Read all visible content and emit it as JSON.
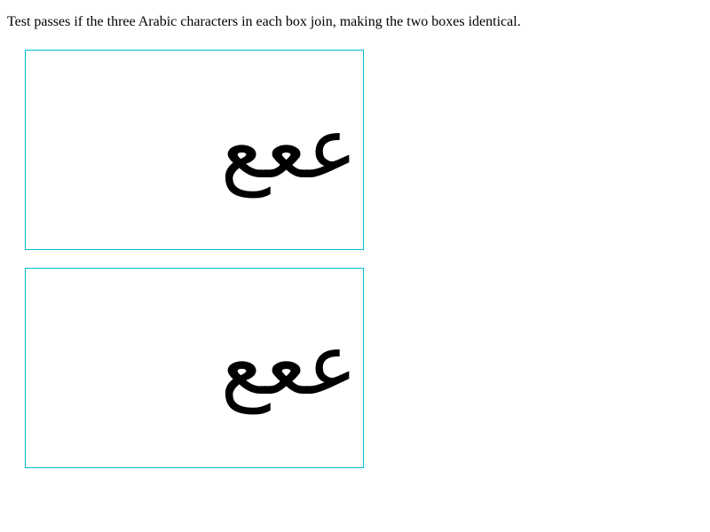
{
  "instructions": "Test passes if the three Arabic characters in each box join, making the two boxes identical.",
  "boxes": [
    {
      "text": "ع‍ع‍ع"
    },
    {
      "text": "ععع"
    }
  ],
  "colors": {
    "box_border": "#00bcd4",
    "text": "#000000",
    "background": "#ffffff"
  }
}
